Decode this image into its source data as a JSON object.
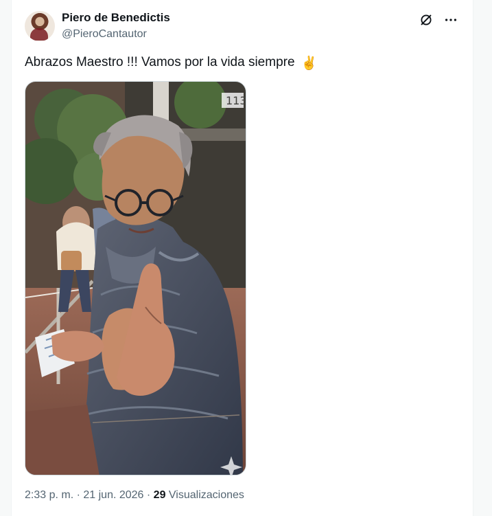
{
  "post": {
    "author": {
      "name": "Piero de Benedictis",
      "handle": "@PieroCantautor"
    },
    "text": "Abrazos Maestro !!! Vamos por la vida siempre",
    "emoji": "✌️",
    "time": "2:33 p. m.",
    "separator1": " · ",
    "date": "21 jun. 2026",
    "separator2": " · ",
    "views_count": "29",
    "views_label": "Visualizaciones"
  },
  "icons": {
    "grok": "grok-icon",
    "more": "more-icon",
    "media_sparkle": "sparkle-icon"
  },
  "colors": {
    "primary_text": "#0f1419",
    "secondary_text": "#536471",
    "border": "#cfd9de",
    "background": "#ffffff"
  }
}
